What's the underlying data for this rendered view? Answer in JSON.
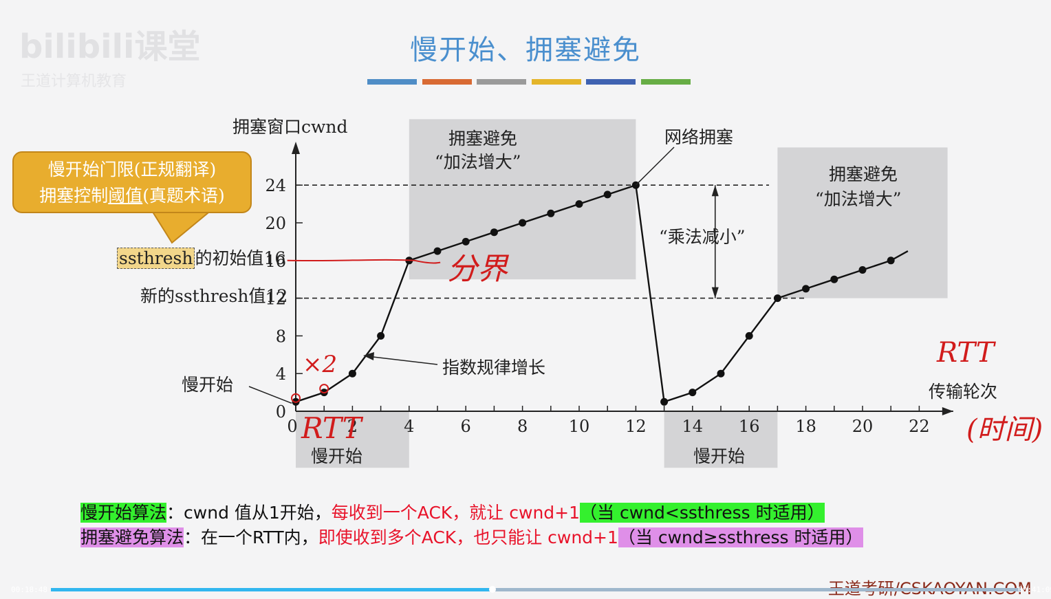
{
  "slide": {
    "title": "慢开始、拥塞避免",
    "watermark_logo": "bilibili课堂",
    "watermark_sub": "王道计算机教育",
    "color_bars": [
      "#4f8dc6",
      "#d86a33",
      "#9a9a9a",
      "#e4b52a",
      "#3f62b1",
      "#67ad45"
    ],
    "callout_line1": "慢开始门限(正规翻译)",
    "callout_line2_prefix": "拥塞控制",
    "callout_line2_underlined": "阈值",
    "callout_line2_suffix": "(真题术语)"
  },
  "chart_data": {
    "type": "line",
    "ylabel": "拥塞窗口cwnd",
    "xlabel": "传输轮次",
    "x_ticks": [
      0,
      2,
      4,
      6,
      8,
      10,
      12,
      14,
      16,
      18,
      20,
      22
    ],
    "y_ticks": [
      0,
      4,
      8,
      12,
      16,
      20,
      24
    ],
    "xlim": [
      0,
      23
    ],
    "ylim": [
      0,
      26
    ],
    "series": [
      {
        "points": [
          [
            0,
            1
          ],
          [
            1,
            2
          ],
          [
            2,
            4
          ],
          [
            3,
            8
          ],
          [
            4,
            16
          ],
          [
            5,
            17
          ],
          [
            6,
            18
          ],
          [
            7,
            19
          ],
          [
            8,
            20
          ],
          [
            9,
            21
          ],
          [
            10,
            22
          ],
          [
            11,
            23
          ],
          [
            12,
            24
          ],
          [
            13,
            1
          ],
          [
            14,
            2
          ],
          [
            15,
            4
          ],
          [
            16,
            8
          ],
          [
            17,
            12
          ],
          [
            18,
            13
          ],
          [
            19,
            14
          ],
          [
            20,
            15
          ],
          [
            21,
            16
          ]
        ],
        "line_end": [
          21.6,
          17
        ]
      }
    ],
    "reference_lines": [
      {
        "y": 24,
        "x_range": [
          0,
          16.7
        ]
      },
      {
        "y": 12,
        "x_range": [
          0,
          18
        ]
      }
    ],
    "shaded_regions": [
      {
        "label_line1": "拥塞避免",
        "label_line2": "“加法增大”",
        "x_range": [
          4,
          12
        ],
        "y_range": [
          14,
          31
        ]
      },
      {
        "label_line1": "拥塞避免",
        "label_line2": "“加法增大”",
        "x_range": [
          17,
          23
        ],
        "y_range": [
          12,
          28
        ]
      },
      {
        "label": "慢开始",
        "x_range": [
          0,
          4
        ],
        "y_range": [
          -6,
          0
        ]
      },
      {
        "label": "慢开始",
        "x_range": [
          13,
          17
        ],
        "y_range": [
          -6,
          0
        ]
      }
    ],
    "annotations": {
      "network_congestion": "网络拥塞",
      "multiplicative_decrease": "“乘法减小”",
      "exponential_growth": "指数规律增长",
      "slow_start_point": "慢开始",
      "ssthresh_initial_prefix": "ssthresh",
      "ssthresh_initial_suffix": "的初始值16",
      "new_ssthresh": "新的ssthresh值12"
    },
    "handwritten": {
      "boundary": "分界",
      "times_two": "×2",
      "rtt_axis": "RTT",
      "rtt_unit": "RTT",
      "time_note": "(时间)"
    }
  },
  "algorithms": {
    "slow_start": {
      "name": "慢开始算法",
      "colon": "：",
      "text": "cwnd 值从1开始，",
      "red_text": "每收到一个ACK，就让 cwnd+1",
      "condition": "（当 cwnd<ssthress 时适用）"
    },
    "congestion_avoidance": {
      "name": "拥塞避免算法",
      "colon": "：",
      "text": "在一个RTT内，",
      "red_text": "即使收到多个ACK，也只能让 cwnd+1",
      "condition": "（当 cwnd≥ssthress 时适用）"
    }
  },
  "footer": {
    "brand": "王道考研/CSKAOYAN.COM",
    "current_time": "00:18:48",
    "total_time": "00:41:09",
    "progress": 0.455
  }
}
